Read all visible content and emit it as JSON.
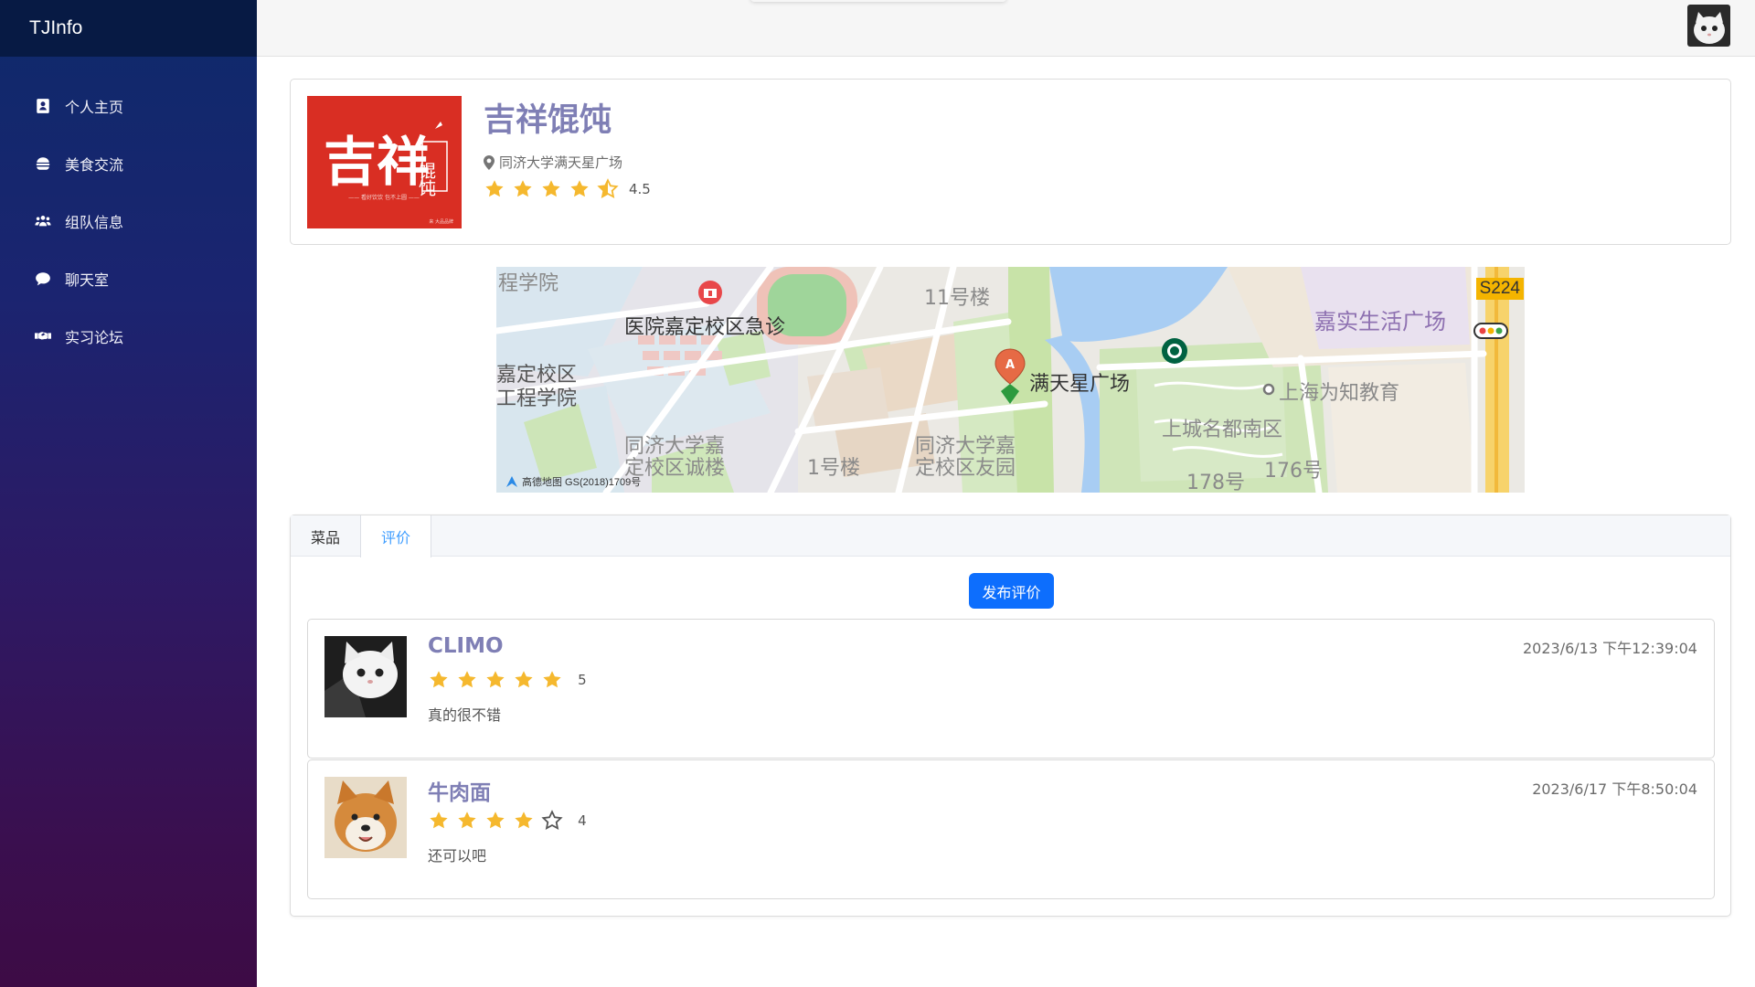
{
  "app": {
    "brand": "TJInfo"
  },
  "sidebar": {
    "items": [
      {
        "label": "个人主页",
        "icon": "profile-card-icon"
      },
      {
        "label": "美食交流",
        "icon": "burger-icon"
      },
      {
        "label": "组队信息",
        "icon": "users-icon"
      },
      {
        "label": "聊天室",
        "icon": "chat-bubble-icon"
      },
      {
        "label": "实习论坛",
        "icon": "handshake-icon"
      }
    ]
  },
  "shop": {
    "name": "吉祥馄饨",
    "location": "同济大学满天星广场",
    "rating": 4.5,
    "rating_text": "4.5",
    "logo_text_main": "吉祥",
    "logo_text_side": "馄饨",
    "logo_tagline": "——  看好饮饮 包不上圆  ——",
    "logo_corner": "来 大品品牌"
  },
  "map": {
    "labels": {
      "top_left": "程学院",
      "hospital": "医院嘉定校区急诊",
      "building11": "11号楼",
      "campus_left_1": "嘉定校区",
      "campus_left_2": "工程学院",
      "chengbuilding_1": "同济大学嘉",
      "chengbuilding_2": "定校区诚楼",
      "building1": "1号楼",
      "youyuan_1": "同济大学嘉",
      "youyuan_2": "定校区友园",
      "marker": "满天星广场",
      "edu": "上海为知教育",
      "community": "上城名都南区",
      "no178": "178号",
      "no176": "176号",
      "plaza": "嘉实生活广场",
      "road": "S224",
      "credit": "高德地图  GS(2018)1709号"
    },
    "marker_letter": "A"
  },
  "tabs": [
    {
      "label": "菜品",
      "active": false
    },
    {
      "label": "评价",
      "active": true
    }
  ],
  "publish_label": "发布评价",
  "reviews": [
    {
      "name": "CLIMO",
      "rating": 5,
      "rating_text": "5",
      "content": "真的很不错",
      "time": "2023/6/13 下午12:39:04",
      "avatar": "white-cat-avatar"
    },
    {
      "name": "牛肉面",
      "rating": 4,
      "rating_text": "4",
      "content": "还可以吧",
      "time": "2023/6/17 下午8:50:04",
      "avatar": "shiba-dog-avatar"
    }
  ],
  "colors": {
    "accent": "#7f7fb5",
    "star": "#f5b82e",
    "primary_button": "#0d6efd",
    "active_tab": "#409eff",
    "logo_red": "#d92e23"
  }
}
